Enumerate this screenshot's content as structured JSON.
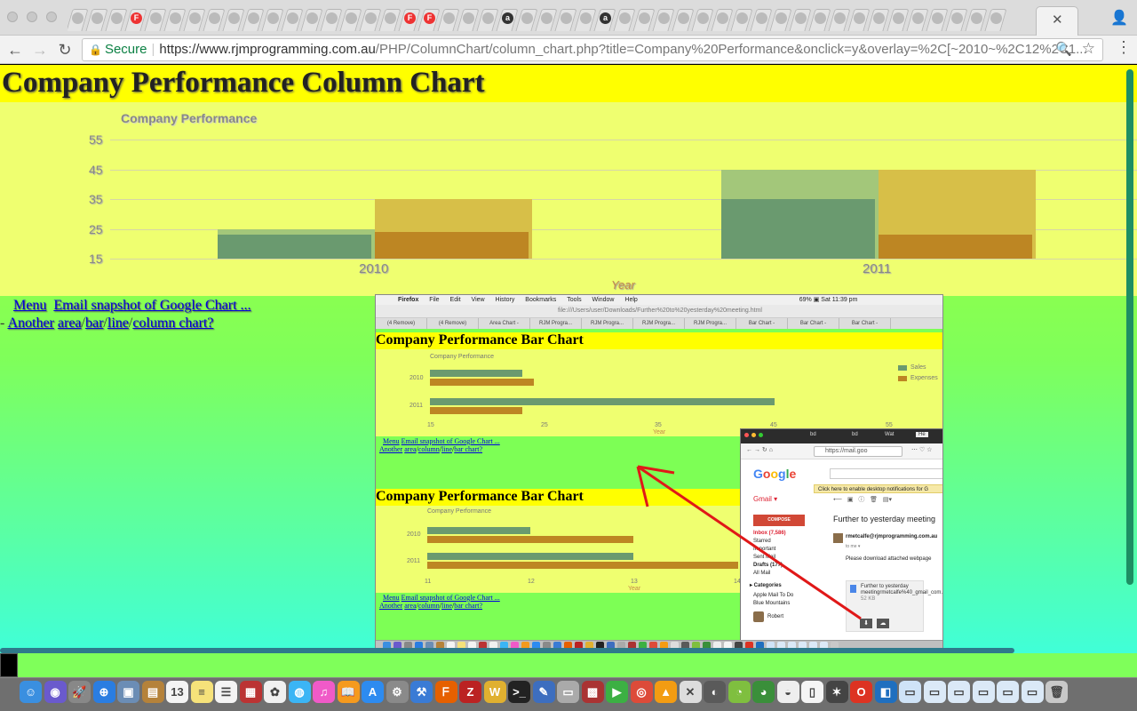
{
  "browser": {
    "tab_favicons": [
      "",
      "",
      "",
      "F",
      "",
      "",
      "",
      "",
      "",
      "",
      "",
      "",
      "",
      "",
      "",
      "",
      "",
      "F",
      "F",
      "",
      "",
      "",
      "a",
      "",
      "",
      "",
      "",
      "a",
      "",
      "",
      "",
      "",
      "",
      "",
      "",
      "",
      "",
      "",
      "",
      "",
      "",
      "",
      "",
      "",
      "",
      "",
      "",
      ""
    ],
    "active_tab_close": "✕",
    "back_icon": "←",
    "forward_icon": "→",
    "reload_icon": "↻",
    "secure_label": "Secure",
    "url_main": "https://www.rjmprogramming.com.au",
    "url_rest": "/PHP/ColumnChart/column_chart.php?title=Company%20Performance&onclick=y&overlay=%2C[~2010~%2C12%2C1...",
    "zoom_icon": "🔍",
    "star_icon": "☆",
    "menu_icon": "⋮",
    "profile_icon": "👤"
  },
  "page": {
    "heading": "Company Performance Column Chart",
    "links": {
      "menu": "Menu",
      "email": "Email snapshot of Google Chart ...",
      "dash": "-",
      "another": "Another",
      "area": "area",
      "slash1": "/",
      "bar": "bar",
      "slash2": "/",
      "line": "line",
      "slash3": "/",
      "column": "column chart?"
    }
  },
  "chart_data": {
    "type": "bar",
    "title": "Company Performance",
    "xlabel": "Year",
    "ylabel": "",
    "categories": [
      "2010",
      "2011"
    ],
    "yticks": [
      "55",
      "45",
      "35",
      "25",
      "15"
    ],
    "ylim": [
      15,
      55
    ],
    "series": [
      {
        "name": "",
        "values": [
          25,
          45
        ],
        "color": "#a3c77a"
      },
      {
        "name": "",
        "values": [
          35,
          45
        ],
        "color": "#d7bf48"
      },
      {
        "name": "",
        "values": [
          23,
          35
        ],
        "color": "#6a9a6f"
      },
      {
        "name": "",
        "values": [
          24,
          23
        ],
        "color": "#bd8623"
      }
    ],
    "grid": true,
    "legend": "none"
  },
  "snapshot": {
    "menubar": {
      "app": "Firefox",
      "items": [
        "File",
        "Edit",
        "View",
        "History",
        "Bookmarks",
        "Tools",
        "Window",
        "Help"
      ],
      "status": "69% ▣  Sat 11:39 pm"
    },
    "ff_url": "file:///Users/user/Downloads/Further%20to%20yesterday%20meeting.html",
    "ff_tabs": [
      "(4 Remove)",
      "(4 Remove)",
      "Area Chart -",
      "RJM Progra...",
      "RJM Progra...",
      "RJM Progra...",
      "RJM Progra...",
      "Bar Chart -",
      "Bar Chart -",
      "Bar Chart -"
    ],
    "chart1": {
      "heading": "Company Performance Bar Chart",
      "title": "Company Performance",
      "rows": [
        "2010",
        "2011"
      ],
      "xticks": [
        "15",
        "25",
        "35",
        "45",
        "55"
      ],
      "xlabel": "Year",
      "legend": [
        "Sales",
        "Expenses"
      ],
      "menu": "Menu",
      "email": "Email snapshot of Google Chart ...",
      "another": "Another",
      "area": "area",
      "column": "column",
      "line": "line",
      "bar": "bar chart?"
    },
    "chart2": {
      "heading": "Company Performance Bar Chart",
      "title": "Company Performance",
      "rows": [
        "2010",
        "2011"
      ],
      "xticks": [
        "11",
        "12",
        "13",
        "14"
      ],
      "xlabel": "Year",
      "menu": "Menu",
      "email": "Email snapshot of Google Chart ...",
      "another": "Another",
      "area": "area",
      "column": "column",
      "line": "line",
      "bar": "bar chart?"
    },
    "gmail": {
      "tabs": [
        "bd",
        "bd",
        "Wat",
        "He"
      ],
      "url": "https://mail.goo",
      "logo": [
        "G",
        "o",
        "o",
        "g",
        "l",
        "e"
      ],
      "notify": "Click here to enable desktop notifications for G",
      "label": "Gmail ▾",
      "compose": "COMPOSE",
      "folders": [
        "Inbox (7,586)",
        "Starred",
        "Important",
        "Sent Mail",
        "Drafts (177)",
        "All Mail",
        "▸ Categories",
        "Apple Mail To Do",
        "Blue Mountains"
      ],
      "user": "Robert",
      "subject": "Further to yesterday meeting",
      "sender": "rmetcalfe@rjmprogramming.com.au",
      "to": "to me ▾",
      "body": "Please download attached webpage",
      "attachment": "Further to yesterday meetingrmetcalfe%40_gmail_com.html",
      "attachment_size": "52 KB"
    }
  },
  "dock": {
    "icons": [
      {
        "name": "finder-icon",
        "color": "#3a8fe0",
        "glyph": "☺"
      },
      {
        "name": "siri-icon",
        "color": "#6a5acd",
        "glyph": "◉"
      },
      {
        "name": "launchpad-icon",
        "color": "#888",
        "glyph": "🚀"
      },
      {
        "name": "safari-icon",
        "color": "#2a7de1",
        "glyph": "⊕"
      },
      {
        "name": "preview-icon",
        "color": "#6b8db5",
        "glyph": "▣"
      },
      {
        "name": "contacts-icon",
        "color": "#b5823a",
        "glyph": "▤"
      },
      {
        "name": "calendar-icon",
        "color": "#f4f4f4",
        "glyph": "13"
      },
      {
        "name": "notes-icon",
        "color": "#f6e27a",
        "glyph": "≡"
      },
      {
        "name": "reminders-icon",
        "color": "#f4f4f4",
        "glyph": "☰"
      },
      {
        "name": "photo-booth-icon",
        "color": "#b33",
        "glyph": "▦"
      },
      {
        "name": "photos-icon",
        "color": "#f0f0f0",
        "glyph": "✿"
      },
      {
        "name": "messages-icon",
        "color": "#3bb5f5",
        "glyph": "◍"
      },
      {
        "name": "itunes-icon",
        "color": "#f05ac8",
        "glyph": "♫"
      },
      {
        "name": "ibooks-icon",
        "color": "#f59a1e",
        "glyph": "📖"
      },
      {
        "name": "app-store-icon",
        "color": "#2d8bf0",
        "glyph": "A"
      },
      {
        "name": "system-prefs-icon",
        "color": "#8a8a8a",
        "glyph": "⚙"
      },
      {
        "name": "xcode-icon",
        "color": "#3a7bd5",
        "glyph": "⚒"
      },
      {
        "name": "firefox-icon",
        "color": "#e66000",
        "glyph": "ᖴ"
      },
      {
        "name": "filezilla-icon",
        "color": "#b22",
        "glyph": "Z"
      },
      {
        "name": "bbedit-icon",
        "color": "#e0b030",
        "glyph": "W"
      },
      {
        "name": "terminal-icon",
        "color": "#222",
        "glyph": ">_"
      },
      {
        "name": "textwrangler-icon",
        "color": "#3d6ebf",
        "glyph": "✎"
      },
      {
        "name": "scanner-icon",
        "color": "#aaa",
        "glyph": "▭"
      },
      {
        "name": "photo-tool-icon",
        "color": "#a33",
        "glyph": "▩"
      },
      {
        "name": "facetime-icon",
        "color": "#3cb043",
        "glyph": "▶"
      },
      {
        "name": "chrome-icon",
        "color": "#dd4b39",
        "glyph": "◎"
      },
      {
        "name": "vlc-icon",
        "color": "#f39c12",
        "glyph": "▲"
      },
      {
        "name": "tool-icon",
        "color": "#ddd",
        "glyph": "✕"
      },
      {
        "name": "spotlight-icon",
        "color": "#5a5a5a",
        "glyph": "◐"
      },
      {
        "name": "android-icon",
        "color": "#7fbf3f",
        "glyph": "◔"
      },
      {
        "name": "android-studio-icon",
        "color": "#3a8f3a",
        "glyph": "◕"
      },
      {
        "name": "github-icon",
        "color": "#eee",
        "glyph": "◒"
      },
      {
        "name": "document-icon",
        "color": "#f5f5f5",
        "glyph": "▯"
      },
      {
        "name": "cat-icon",
        "color": "#444",
        "glyph": "✶"
      },
      {
        "name": "opera-icon",
        "color": "#d32",
        "glyph": "O"
      },
      {
        "name": "vscode-icon",
        "color": "#1f6fbf",
        "glyph": "◧"
      },
      {
        "name": "folder-icon",
        "color": "#cfe3f7",
        "glyph": "▭"
      },
      {
        "name": "folder2-icon",
        "color": "#dbe9f7",
        "glyph": "▭"
      },
      {
        "name": "folder3-icon",
        "color": "#dbe9f7",
        "glyph": "▭"
      },
      {
        "name": "folder4-icon",
        "color": "#dbe9f7",
        "glyph": "▭"
      },
      {
        "name": "folder5-icon",
        "color": "#dbe9f7",
        "glyph": "▭"
      },
      {
        "name": "folder6-icon",
        "color": "#dbe9f7",
        "glyph": "▭"
      },
      {
        "name": "trash-icon",
        "color": "#c8c8c8",
        "glyph": "🗑"
      }
    ]
  }
}
